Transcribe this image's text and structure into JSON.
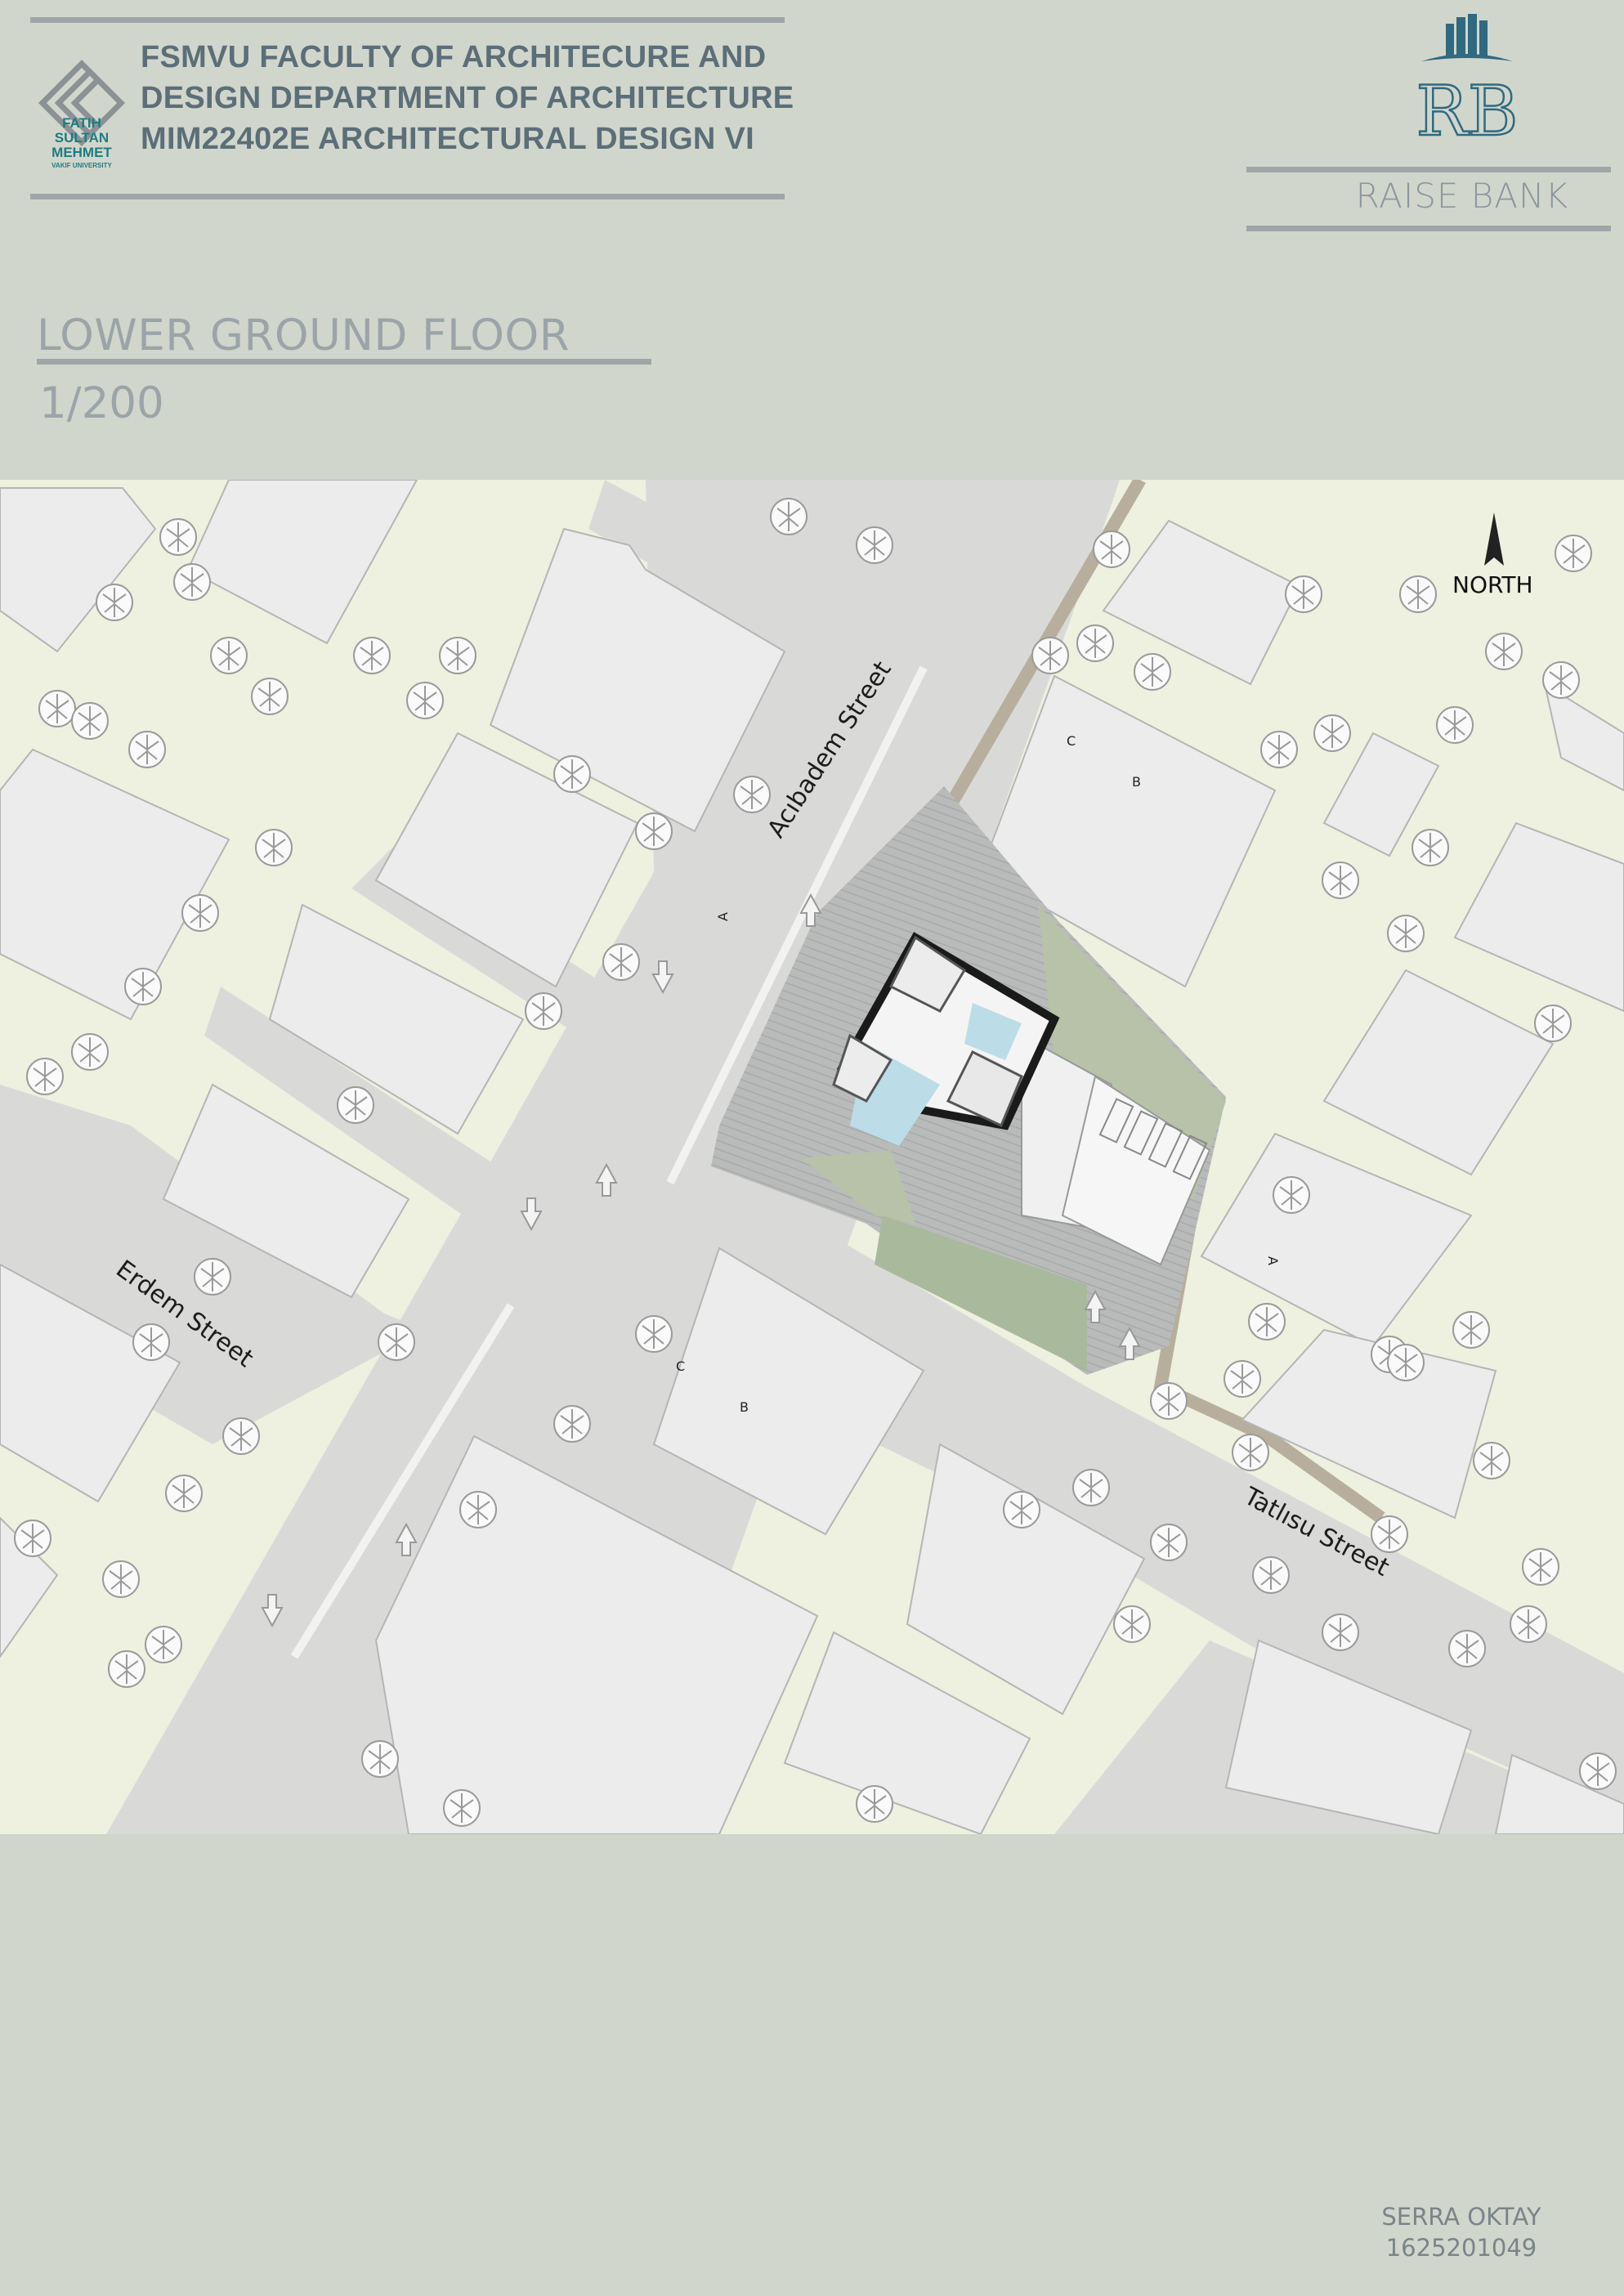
{
  "header": {
    "faculty_lines": [
      "FSMVU FACULTY OF ARCHITECURE AND",
      "DESIGN DEPARTMENT OF ARCHITECTURE",
      "MIM22402E ARCHITECTURAL DESIGN VI"
    ],
    "university_logo": {
      "icon": "fsmvu-logo-icon",
      "lines": [
        "FATIH",
        "SULTAN",
        "MEHMET"
      ],
      "sub": "VAKIF UNIVERSITY"
    },
    "bank_logo": {
      "icon": "raise-bank-logo-icon",
      "monogram": "RB"
    },
    "bank_name": "RAISE BANK"
  },
  "drawing": {
    "title": "LOWER GROUND FLOOR",
    "scale": "1/200",
    "north_label": "NORTH",
    "streets": {
      "acibadem": "Acıbadem Street",
      "erdem": "Erdem Street",
      "tatlisu": "Tatlısu Street"
    },
    "section_marks": [
      "A",
      "B",
      "C"
    ]
  },
  "footer": {
    "author": "SERRA OKTAY",
    "student_id": "1625201049"
  },
  "colors": {
    "background": "#d1d6cc",
    "ground": "#eef1df",
    "road": "#d9dad8",
    "building": "#ececec",
    "title_text": "#5c6e78",
    "accent_teal": "#1f7c80"
  }
}
